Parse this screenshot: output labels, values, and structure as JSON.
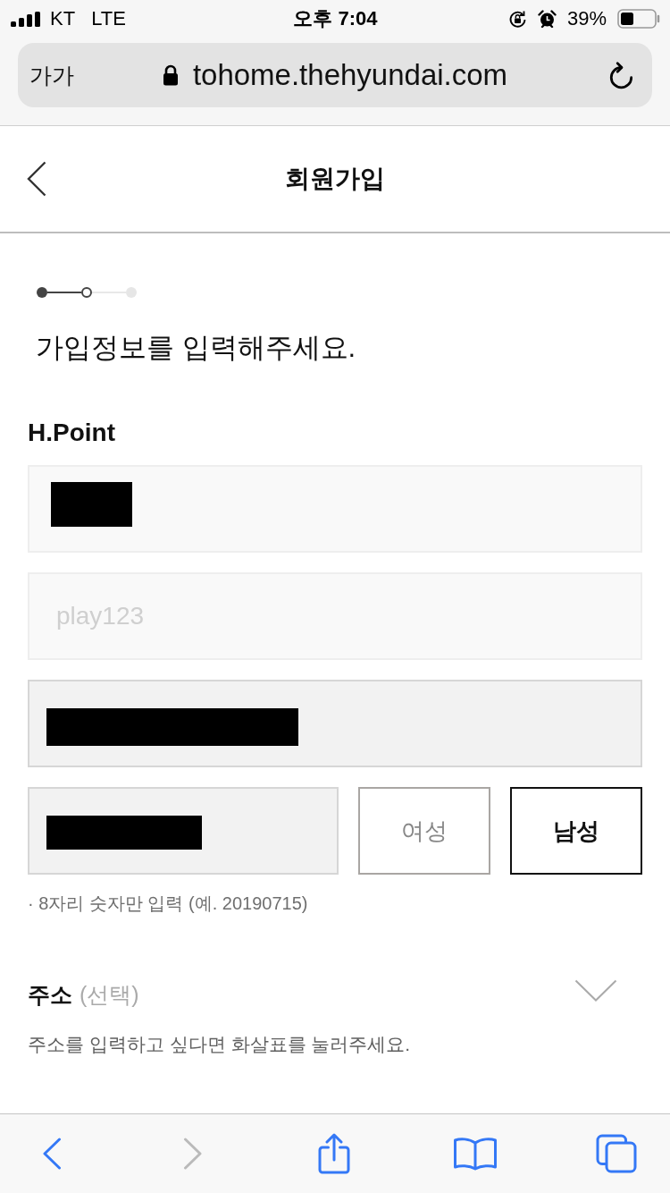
{
  "status_bar": {
    "carrier": "KT",
    "network": "LTE",
    "time": "오후 7:04",
    "battery": "39%"
  },
  "address_bar": {
    "text_size": "가가",
    "url": "tohome.thehyundai.com"
  },
  "header": {
    "title": "회원가입"
  },
  "steps": [
    {
      "done": true,
      "current": false
    },
    {
      "done": false,
      "current": true
    },
    {
      "done": false,
      "current": false
    }
  ],
  "heading": "가입정보를 입력해주세요.",
  "section": {
    "title": "H.Point",
    "fields": [
      {
        "kind": "name",
        "redacted": true,
        "readonly": false
      },
      {
        "kind": "id",
        "placeholder": "play123",
        "redacted": false,
        "readonly": false
      },
      {
        "kind": "phone",
        "redacted": true,
        "readonly": true
      }
    ]
  },
  "birth_row": {
    "field": {
      "kind": "birthdate",
      "redacted": true,
      "readonly": true
    },
    "genders": [
      {
        "label": "여성",
        "selected": false
      },
      {
        "label": "남성",
        "selected": true
      }
    ],
    "hint": "· 8자리 숫자만 입력 (예. 20190715)"
  },
  "address": {
    "title": "주소",
    "optional": "(선택)",
    "expanded": false,
    "hint": "주소를 입력하고 싶다면 화살표를 눌러주세요."
  },
  "toolbar": [
    {
      "kind": "back",
      "disabled": false
    },
    {
      "kind": "forward",
      "disabled": true
    },
    {
      "kind": "share",
      "disabled": false
    },
    {
      "kind": "bookmarks",
      "disabled": false
    },
    {
      "kind": "tabs",
      "disabled": false
    }
  ]
}
